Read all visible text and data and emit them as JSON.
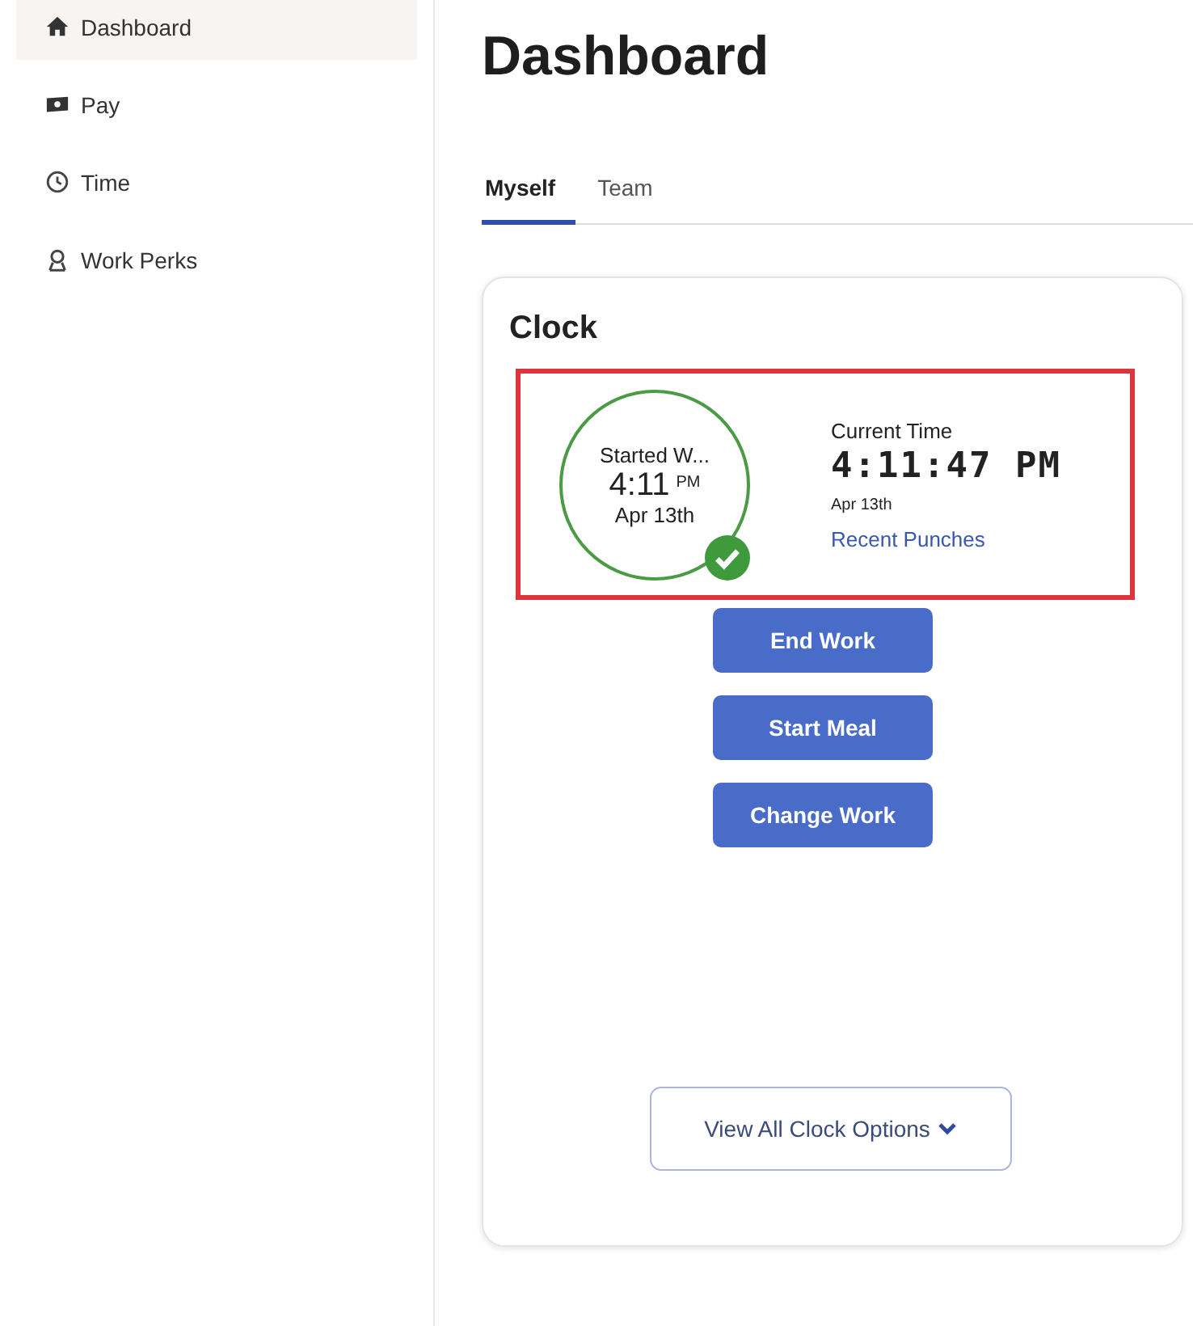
{
  "sidebar": {
    "items": [
      {
        "label": "Dashboard",
        "selected": true
      },
      {
        "label": "Pay",
        "selected": false
      },
      {
        "label": "Time",
        "selected": false
      },
      {
        "label": "Work Perks",
        "selected": false
      }
    ]
  },
  "page_title": "Dashboard",
  "tabs": [
    {
      "label": "Myself",
      "selected": true
    },
    {
      "label": "Team",
      "selected": false
    }
  ],
  "clock_card": {
    "title": "Clock",
    "highlighted": true,
    "status": {
      "label": "Started W...",
      "time": "4:11",
      "ampm": "PM",
      "date": "Apr 13th",
      "confirmed": true
    },
    "current": {
      "label": "Current Time",
      "time": "4:11:47 PM",
      "date": "Apr 13th",
      "link": "Recent Punches"
    },
    "buttons": [
      "End Work",
      "Start Meal",
      "Change Work"
    ],
    "options_button": "View All Clock Options"
  }
}
